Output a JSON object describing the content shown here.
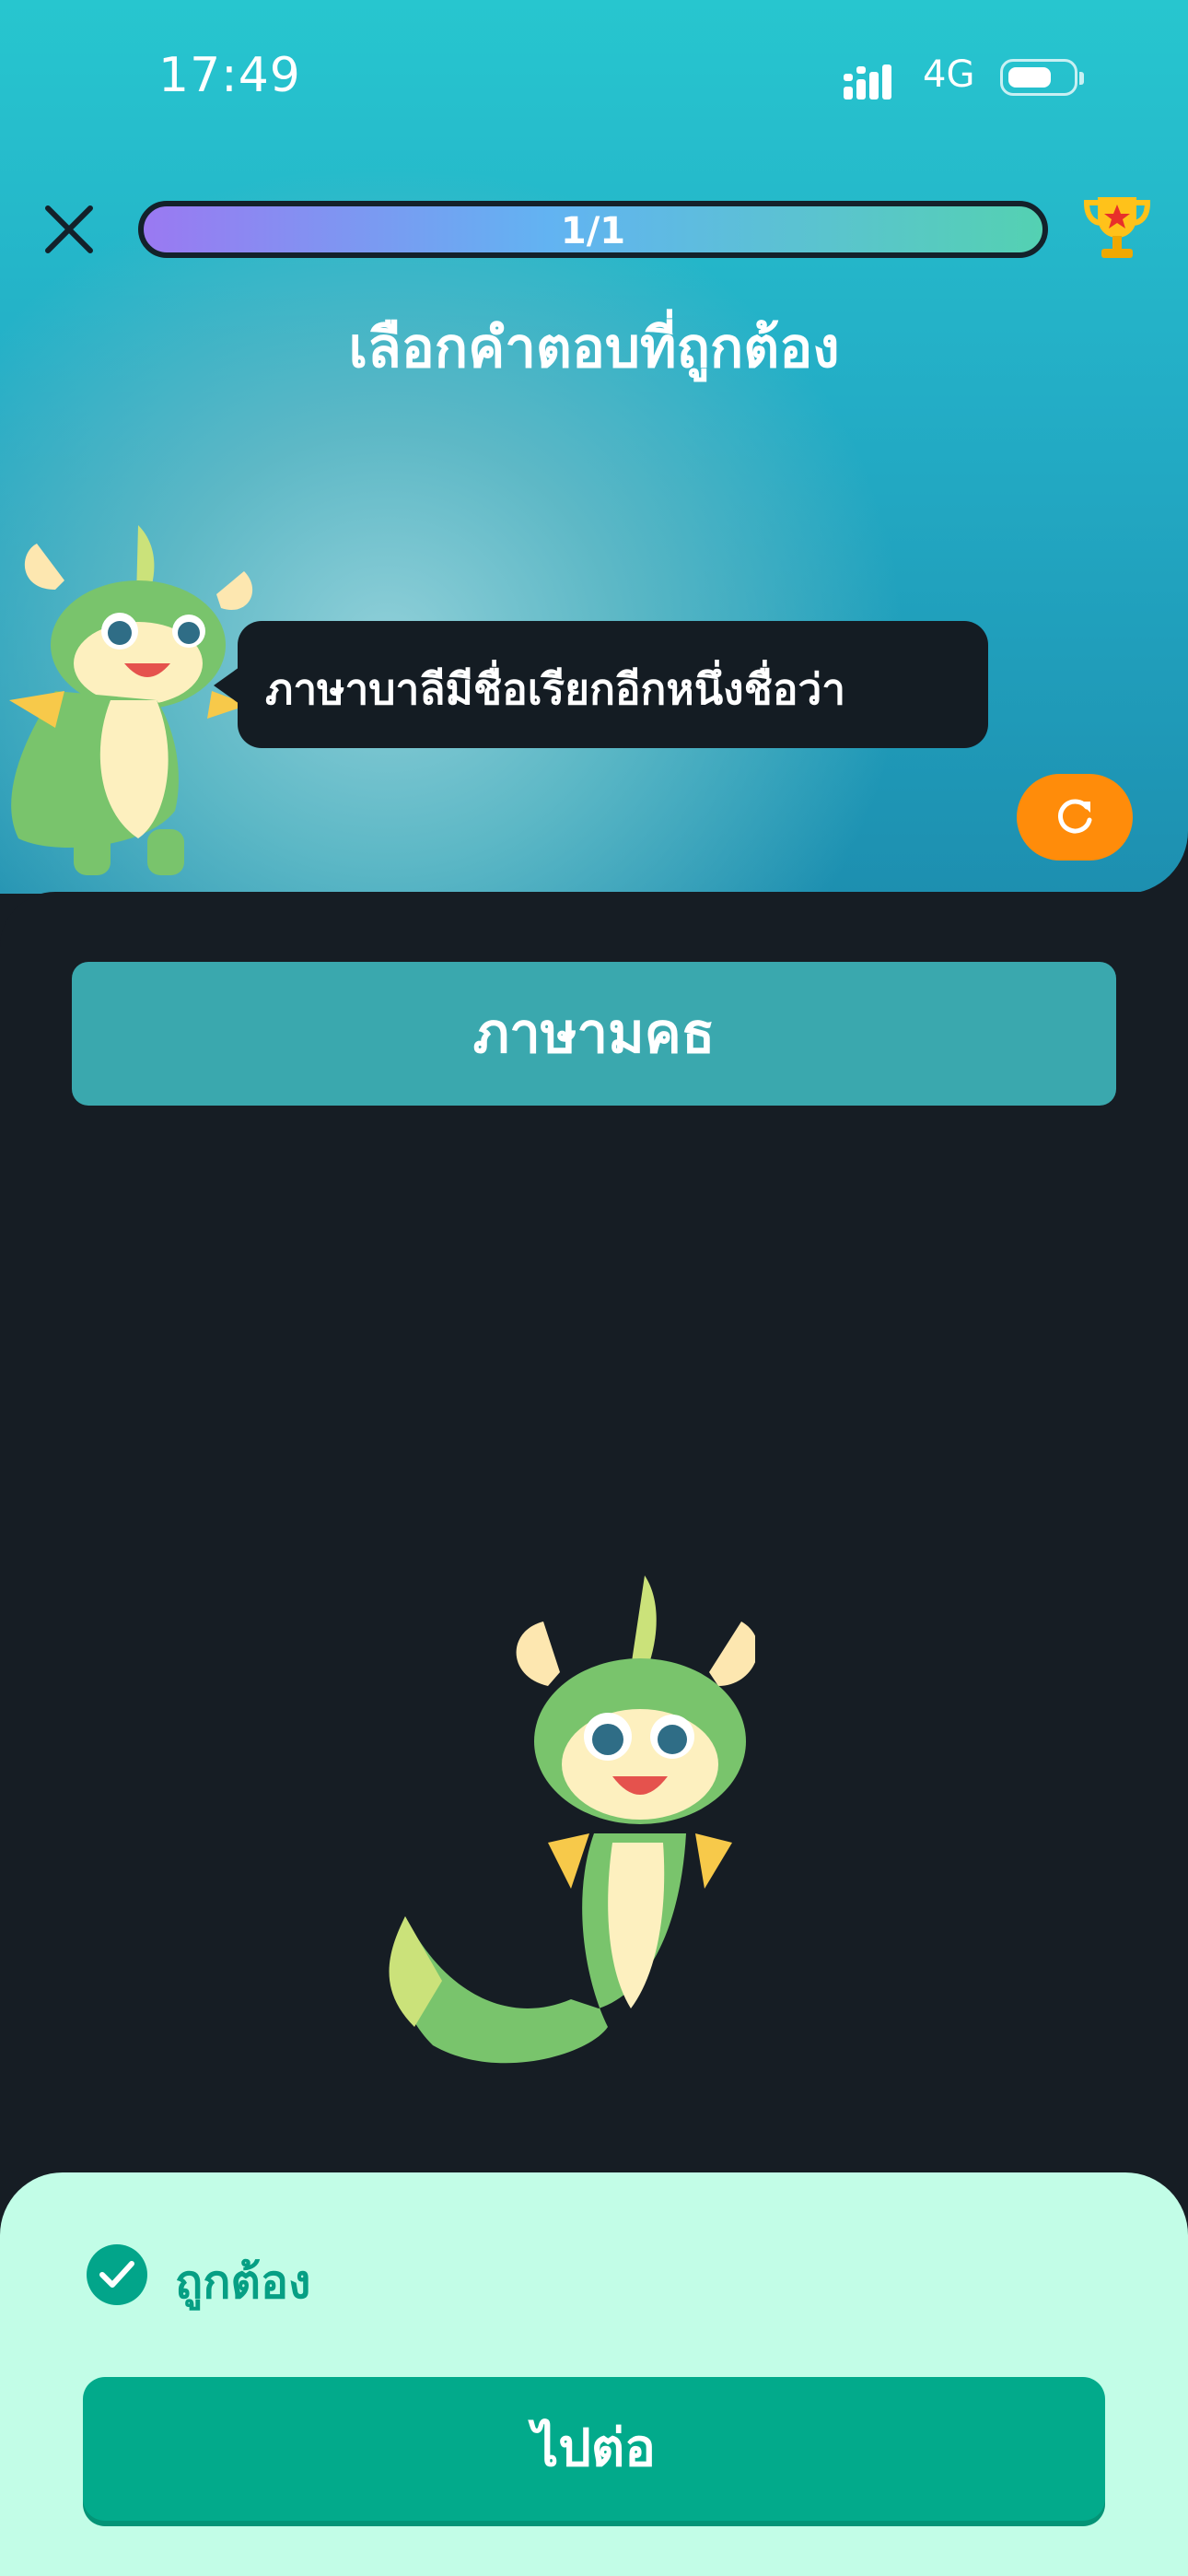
{
  "status_bar": {
    "time": "17:49",
    "network": "4G"
  },
  "header": {
    "progress_label": "1/1",
    "progress_fraction": 1.0
  },
  "question": {
    "instruction": "เลือกคำตอบที่ถูกต้อง",
    "prompt": "ภาษาบาลีมีชื่อเรียกอีกหนึ่งชื่อว่า"
  },
  "answer": {
    "selected_text": "ภาษามคธ"
  },
  "result": {
    "label": "ถูกต้อง",
    "continue_label": "ไปต่อ"
  },
  "colors": {
    "correct_green": "#02aa8b",
    "replay_orange": "#ff8c0a",
    "answer_teal": "#3aa8ae",
    "sheet_bg": "#c2fde7"
  },
  "icons": [
    "close-icon",
    "trophy-icon",
    "replay-icon",
    "check-circle-icon",
    "signal-icon",
    "battery-icon"
  ]
}
